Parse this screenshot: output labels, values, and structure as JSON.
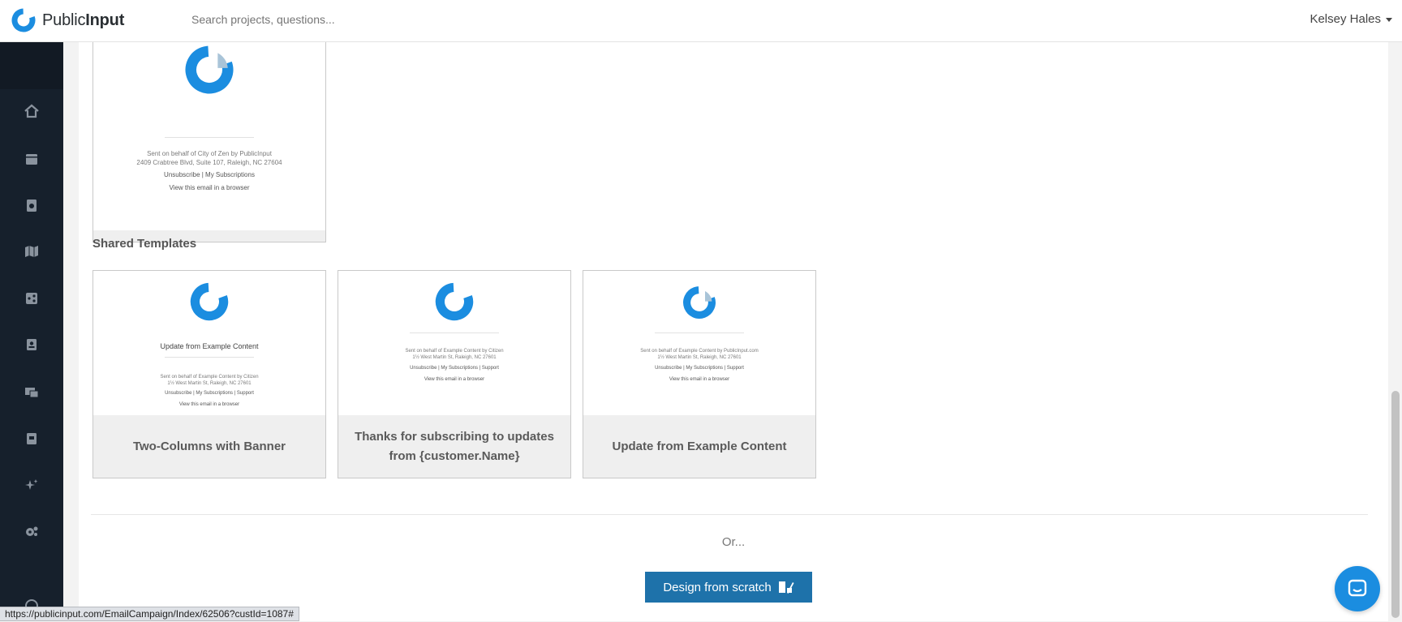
{
  "header": {
    "brand_prefix": "Public",
    "brand_suffix": "Input",
    "search_placeholder": "Search projects, questions...",
    "user_name": "Kelsey Hales"
  },
  "sidebar": {
    "items": [
      {
        "icon": "home-icon"
      },
      {
        "icon": "calendar-icon"
      },
      {
        "icon": "report-icon"
      },
      {
        "icon": "map-icon"
      },
      {
        "icon": "share-icon"
      },
      {
        "icon": "contacts-icon"
      },
      {
        "icon": "inbox-icon"
      },
      {
        "icon": "book-icon"
      },
      {
        "icon": "sparkle-icon"
      },
      {
        "icon": "settings-icon"
      },
      {
        "icon": "help-icon"
      }
    ]
  },
  "top_template": {
    "lines": [
      "Sent on behalf of City of Zen by PublicInput",
      "2409 Crabtree Blvd, Suite 107, Raleigh, NC 27604",
      "Unsubscribe | My Subscriptions",
      "View this email in a browser"
    ]
  },
  "shared_templates": {
    "title": "Shared Templates",
    "cards": [
      {
        "name": "Two-Columns with Banner",
        "preview_heading": "Update from Example Content",
        "lines": [
          "Sent on behalf of Example Content by Citizen",
          "1½ West Martin St, Raleigh, NC 27601",
          "Unsubscribe | My Subscriptions | Support",
          "View this email in a browser"
        ]
      },
      {
        "name": "Thanks for subscribing to updates from {customer.Name}",
        "lines": [
          "Sent on behalf of Example Content by Citizen",
          "1½ West Martin St, Raleigh, NC 27601",
          "Unsubscribe | My Subscriptions | Support",
          "View this email in a browser"
        ]
      },
      {
        "name": "Update from Example Content",
        "lines": [
          "Sent on behalf of Example Content by PublicInput.com",
          "1½ West Martin St, Raleigh, NC 27601",
          "Unsubscribe | My Subscriptions | Support",
          "View this email in a browser"
        ]
      }
    ]
  },
  "footer": {
    "or_text": "Or...",
    "design_button": "Design from scratch"
  },
  "status_bar_url": "https://publicinput.com/EmailCampaign/Index/62506?custId=1087#",
  "colors": {
    "brand_blue": "#1b8de0",
    "sidebar_bg": "#16202c",
    "button_bg": "#1e72aa"
  }
}
